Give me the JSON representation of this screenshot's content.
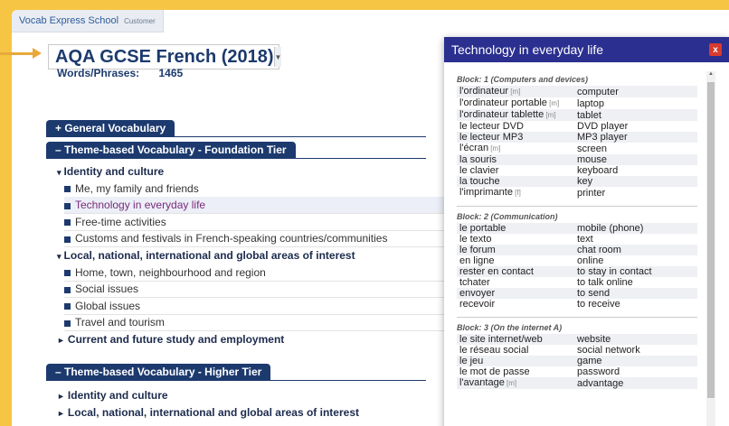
{
  "school": {
    "name": "Vocab Express School",
    "role": "Customer"
  },
  "course": {
    "title": "AQA GCSE French (2018)",
    "words_label": "Words/Phrases:",
    "words_count": "1465"
  },
  "sections": {
    "general": "+ General Vocabulary",
    "foundation": "– Theme-based Vocabulary - Foundation Tier",
    "higher": "– Theme-based Vocabulary - Higher Tier"
  },
  "foundation_tree": [
    {
      "type": "head",
      "label": "Identity and culture",
      "marker": "▾"
    },
    {
      "type": "item",
      "label": "Me, my family and friends"
    },
    {
      "type": "item",
      "label": "Technology in everyday life",
      "active": true
    },
    {
      "type": "item",
      "label": "Free-time activities"
    },
    {
      "type": "item",
      "label": "Customs and festivals in French-speaking countries/communities"
    },
    {
      "type": "head",
      "label": "Local, national, international and global areas of interest",
      "marker": "▾"
    },
    {
      "type": "item",
      "label": "Home, town, neighbourhood and region"
    },
    {
      "type": "item",
      "label": "Social issues"
    },
    {
      "type": "item",
      "label": "Global issues"
    },
    {
      "type": "item",
      "label": "Travel and tourism"
    },
    {
      "type": "head",
      "label": "Current and future study and employment",
      "marker": "►"
    }
  ],
  "higher_tree": [
    {
      "type": "head",
      "label": "Identity and culture",
      "marker": "►"
    },
    {
      "type": "head",
      "label": "Local, national, international and global areas of interest",
      "marker": "►"
    }
  ],
  "popup": {
    "title": "Technology in everyday life",
    "close": "x",
    "blocks": [
      {
        "label": "Block: 1 (Computers and devices)",
        "rows": [
          {
            "fr": "l'ordinateur",
            "g": "[m]",
            "en": "computer"
          },
          {
            "fr": "l'ordinateur portable",
            "g": "[m]",
            "en": "laptop"
          },
          {
            "fr": "l'ordinateur tablette",
            "g": "[m]",
            "en": "tablet"
          },
          {
            "fr": "le lecteur DVD",
            "g": "",
            "en": "DVD player"
          },
          {
            "fr": "le lecteur MP3",
            "g": "",
            "en": "MP3 player"
          },
          {
            "fr": "l'écran",
            "g": "[m]",
            "en": "screen"
          },
          {
            "fr": "la souris",
            "g": "",
            "en": "mouse"
          },
          {
            "fr": "le clavier",
            "g": "",
            "en": "keyboard"
          },
          {
            "fr": "la touche",
            "g": "",
            "en": "key"
          },
          {
            "fr": "l'imprimante",
            "g": "[f]",
            "en": "printer"
          }
        ]
      },
      {
        "label": "Block: 2 (Communication)",
        "rows": [
          {
            "fr": "le portable",
            "g": "",
            "en": "mobile (phone)"
          },
          {
            "fr": "le texto",
            "g": "",
            "en": "text"
          },
          {
            "fr": "le forum",
            "g": "",
            "en": "chat room"
          },
          {
            "fr": "en ligne",
            "g": "",
            "en": "online"
          },
          {
            "fr": "rester en contact",
            "g": "",
            "en": "to stay in contact"
          },
          {
            "fr": "tchater",
            "g": "",
            "en": "to talk online"
          },
          {
            "fr": "envoyer",
            "g": "",
            "en": "to send"
          },
          {
            "fr": "recevoir",
            "g": "",
            "en": "to receive"
          }
        ]
      },
      {
        "label": "Block: 3 (On the internet A)",
        "rows": [
          {
            "fr": "le site internet/web",
            "g": "",
            "en": "website"
          },
          {
            "fr": "le réseau social",
            "g": "",
            "en": "social network"
          },
          {
            "fr": "le jeu",
            "g": "",
            "en": "game"
          },
          {
            "fr": "le mot de passe",
            "g": "",
            "en": "password"
          },
          {
            "fr": "l'avantage",
            "g": "[m]",
            "en": "advantage"
          }
        ]
      }
    ]
  }
}
